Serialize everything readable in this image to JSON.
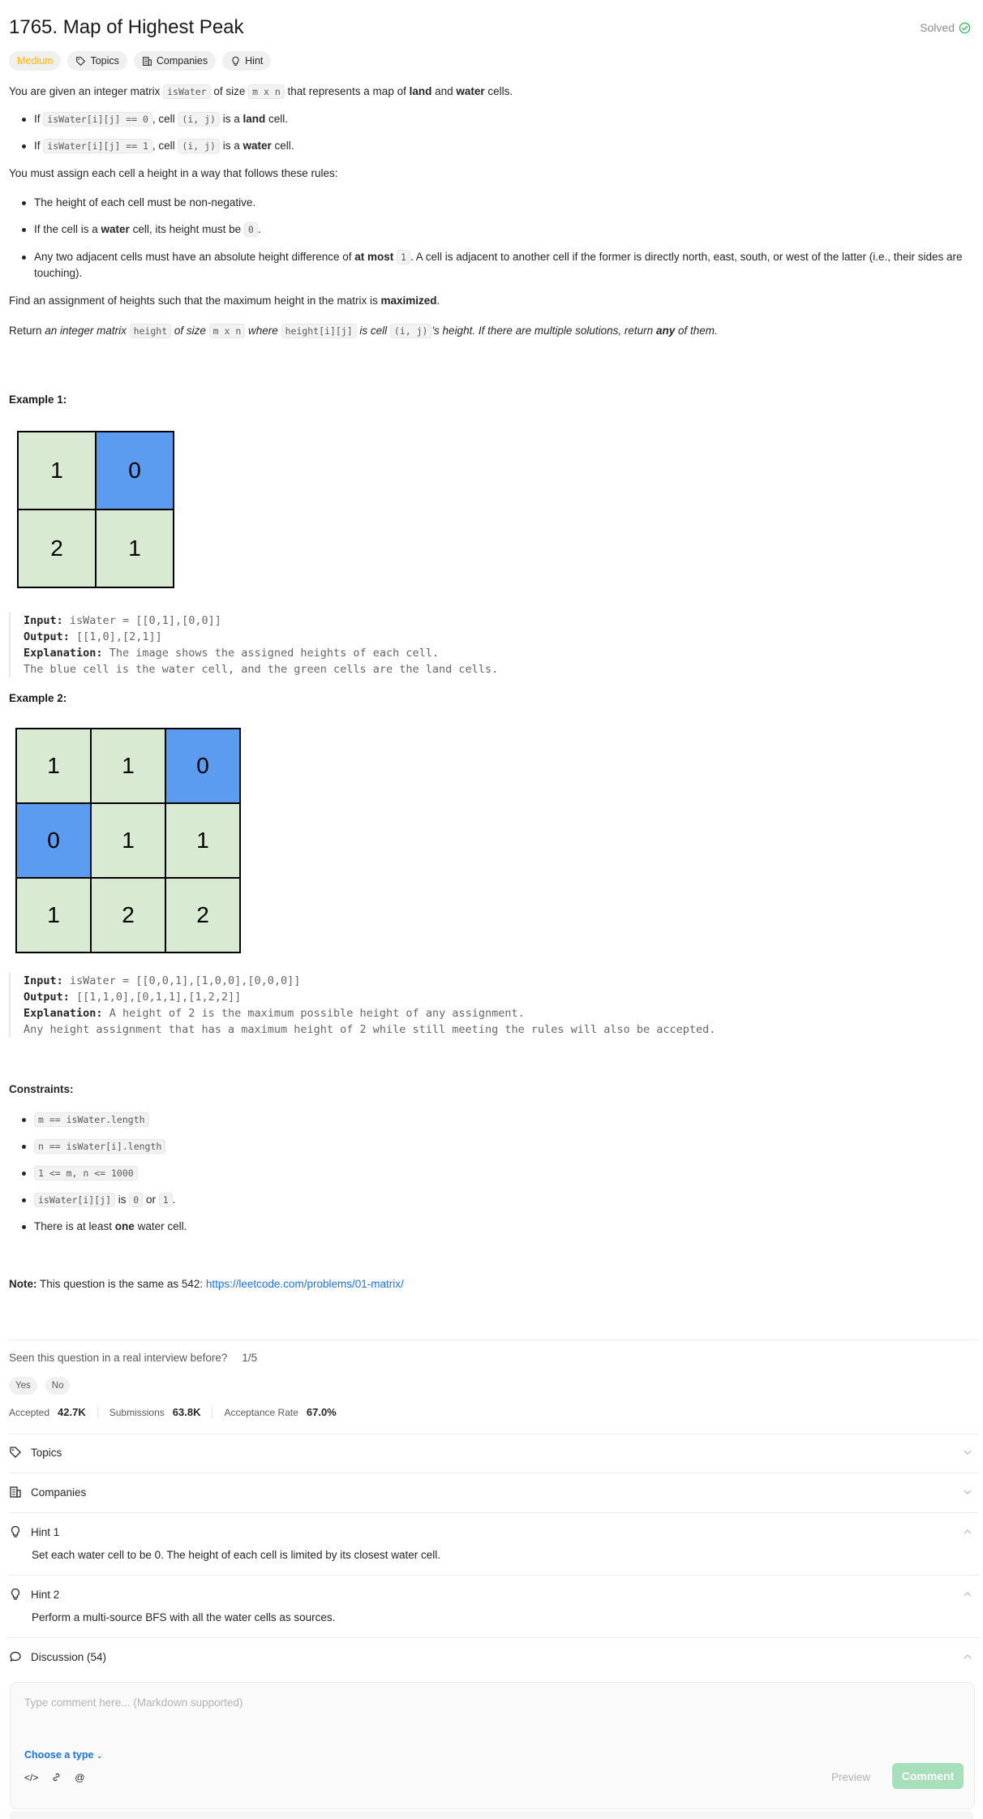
{
  "problem": {
    "title": "1765. Map of Highest Peak",
    "status": "Solved",
    "difficulty": "Medium",
    "tags": [
      "Topics",
      "Companies",
      "Hint"
    ]
  },
  "description": {
    "p1": [
      "You are given an integer matrix ",
      "isWater",
      " of size ",
      "m x n",
      " that represents a map of ",
      "land",
      " and ",
      "water",
      " cells."
    ],
    "bullets1": [
      [
        "If ",
        "isWater[i][j] == 0",
        ", cell ",
        "(i, j)",
        " is a ",
        "land",
        " cell."
      ],
      [
        "If ",
        "isWater[i][j] == 1",
        ", cell ",
        "(i, j)",
        " is a ",
        "water",
        " cell."
      ]
    ],
    "p2": "You must assign each cell a height in a way that follows these rules:",
    "rules": [
      "The height of each cell must be non-negative.",
      [
        "If the cell is a ",
        "water",
        " cell, its height must be ",
        "0",
        "."
      ],
      [
        "Any two adjacent cells must have an absolute height difference of ",
        "at most",
        " ",
        "1",
        ". A cell is adjacent to another cell if the former is directly north, east, south, or west of the latter (i.e., their sides are touching)."
      ]
    ],
    "p3": [
      "Find an assignment of heights such that the maximum height in the matrix is ",
      "maximized",
      "."
    ],
    "p4": [
      "Return ",
      "an integer matrix ",
      "height",
      " of size ",
      "m x n",
      " where ",
      "height[i][j]",
      " is cell ",
      "(i, j)",
      "'s height. If there are multiple solutions, return ",
      "any",
      " of them."
    ]
  },
  "examples": [
    {
      "label": "Example 1:",
      "grid": [
        [
          {
            "v": "1",
            "t": "land"
          },
          {
            "v": "0",
            "t": "water"
          }
        ],
        [
          {
            "v": "2",
            "t": "land"
          },
          {
            "v": "1",
            "t": "land"
          }
        ]
      ],
      "input_label": "Input:",
      "input": "isWater = [[0,1],[0,0]]",
      "output_label": "Output:",
      "output": "[[1,0],[2,1]]",
      "explanation_label": "Explanation:",
      "explanation": "The image shows the assigned heights of each cell.",
      "explanation2": "The blue cell is the water cell, and the green cells are the land cells."
    },
    {
      "label": "Example 2:",
      "grid": [
        [
          {
            "v": "1",
            "t": "land"
          },
          {
            "v": "1",
            "t": "land"
          },
          {
            "v": "0",
            "t": "water"
          }
        ],
        [
          {
            "v": "0",
            "t": "water"
          },
          {
            "v": "1",
            "t": "land"
          },
          {
            "v": "1",
            "t": "land"
          }
        ],
        [
          {
            "v": "1",
            "t": "land"
          },
          {
            "v": "2",
            "t": "land"
          },
          {
            "v": "2",
            "t": "land"
          }
        ]
      ],
      "input_label": "Input:",
      "input": "isWater = [[0,0,1],[1,0,0],[0,0,0]]",
      "output_label": "Output:",
      "output": "[[1,1,0],[0,1,1],[1,2,2]]",
      "explanation_label": "Explanation:",
      "explanation": "A height of 2 is the maximum possible height of any assignment.",
      "explanation2": "Any height assignment that has a maximum height of 2 while still meeting the rules will also be accepted."
    }
  ],
  "constraints": {
    "label": "Constraints:",
    "items": [
      {
        "code": "m == isWater.length"
      },
      {
        "code": "n == isWater[i].length"
      },
      {
        "code": "1 <= m, n <= 1000"
      },
      {
        "parts": [
          "isWater[i][j]",
          " is ",
          "0",
          " or ",
          "1",
          "."
        ]
      },
      {
        "text": [
          "There is at least ",
          "one",
          " water cell."
        ]
      }
    ]
  },
  "note": {
    "label": "Note:",
    "text": " This question is the same as 542: ",
    "link": "https://leetcode.com/problems/01-matrix/"
  },
  "interview": {
    "question": "Seen this question in a real interview before?",
    "ratio": "1/5",
    "yes": "Yes",
    "no": "No"
  },
  "stats": {
    "accepted_label": "Accepted",
    "accepted": "42.7K",
    "submissions_label": "Submissions",
    "submissions": "63.8K",
    "rate_label": "Acceptance Rate",
    "rate": "67.0%"
  },
  "sections": {
    "topics": "Topics",
    "companies": "Companies",
    "hint1": "Hint 1",
    "hint1_text": "Set each water cell to be 0. The height of each cell is limited by its closest water cell.",
    "hint2": "Hint 2",
    "hint2_text": "Perform a multi-source BFS with all the water cells as sources.",
    "discussion": "Discussion (54)"
  },
  "comment": {
    "placeholder": "Type comment here... (Markdown supported)",
    "choose_type": "Choose a type",
    "preview": "Preview",
    "submit": "Comment"
  },
  "colors": {
    "accent": "#1a73e8",
    "medium": "#ffb800",
    "solved": "#2cbb5d",
    "land": "#d9ead3",
    "water": "#5b9bf0"
  }
}
